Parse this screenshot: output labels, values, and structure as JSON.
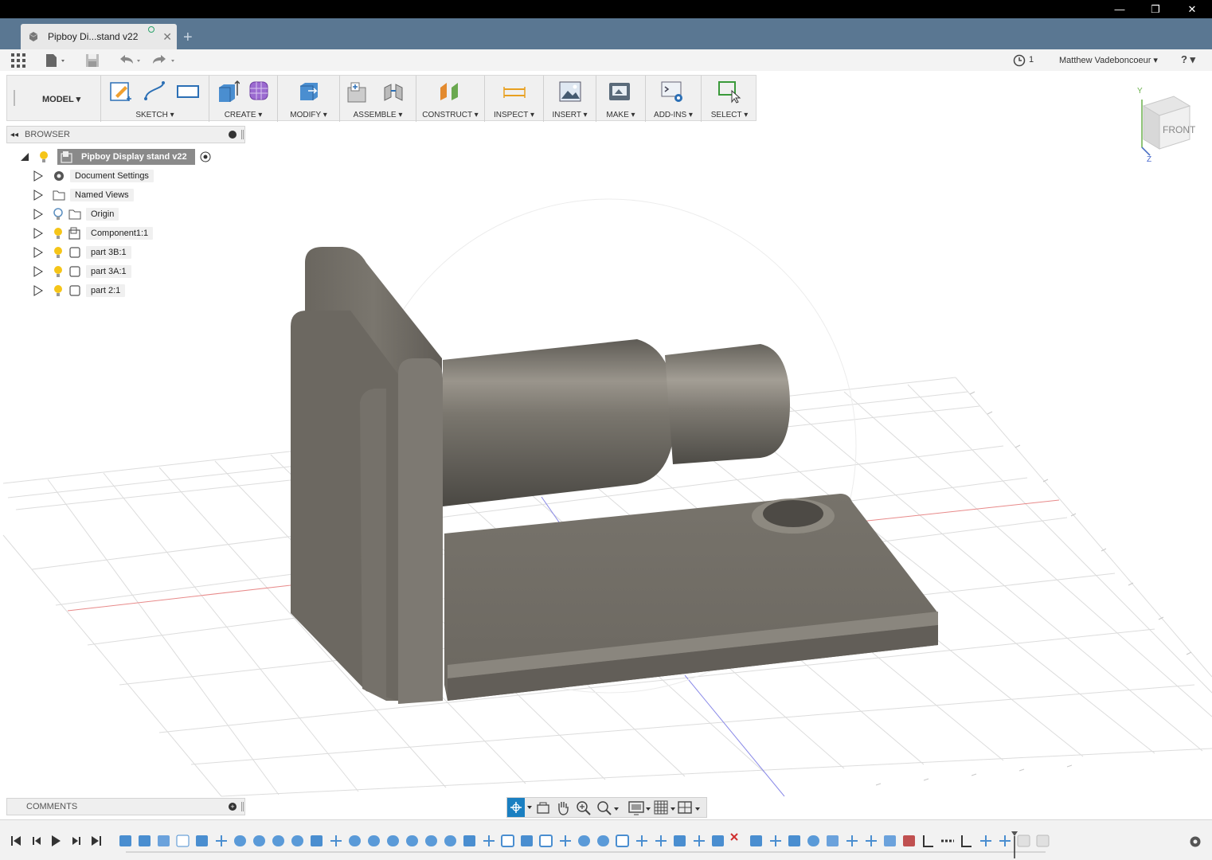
{
  "window": {
    "minimize": "—",
    "restore": "❐",
    "close": "✕"
  },
  "tab": {
    "title": "Pipboy Di...stand v22",
    "close": "✕",
    "new": "+"
  },
  "qat": {
    "version_count": "1",
    "user": "Matthew Vadeboncoeur ▾",
    "help": "? ▾"
  },
  "workspace": {
    "label": "MODEL ▾"
  },
  "toolbar": {
    "groups": [
      {
        "label": "SKETCH ▾"
      },
      {
        "label": "CREATE ▾"
      },
      {
        "label": "MODIFY ▾"
      },
      {
        "label": "ASSEMBLE ▾"
      },
      {
        "label": "CONSTRUCT ▾"
      },
      {
        "label": "INSPECT ▾"
      },
      {
        "label": "INSERT ▾"
      },
      {
        "label": "MAKE ▾"
      },
      {
        "label": "ADD-INS ▾"
      },
      {
        "label": "SELECT ▾"
      }
    ]
  },
  "browser": {
    "title": "BROWSER",
    "root": "Pipboy Display stand v22",
    "items": [
      {
        "label": "Document Settings"
      },
      {
        "label": "Named Views"
      },
      {
        "label": "Origin"
      },
      {
        "label": "Component1:1"
      },
      {
        "label": "part 3B:1"
      },
      {
        "label": "part 3A:1"
      },
      {
        "label": "part 2:1"
      }
    ]
  },
  "comments": {
    "title": "COMMENTS"
  },
  "viewcube": {
    "face": "FRONT",
    "axis_y": "Y",
    "axis_z": "Z"
  },
  "colors": {
    "tabbar": "#5a7792",
    "accent": "#1a7fc1",
    "model": "#6e6a63"
  }
}
